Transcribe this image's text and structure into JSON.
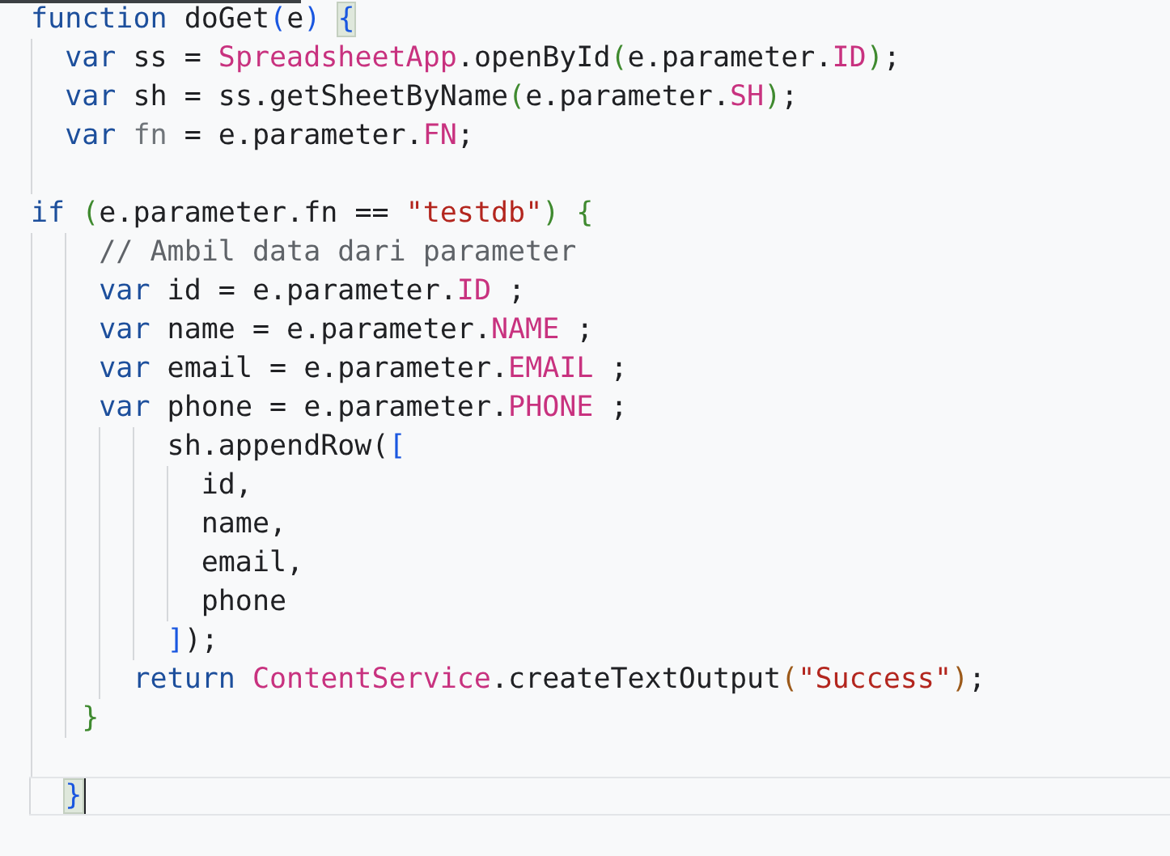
{
  "editor": {
    "lines": [
      {
        "kind": "code",
        "tokens": [
          {
            "kind": "keyword",
            "text": "function"
          },
          {
            "kind": "plain",
            "text": " doGet"
          },
          {
            "kind": "bracket1",
            "text": "("
          },
          {
            "kind": "plain",
            "text": "e"
          },
          {
            "kind": "bracket1",
            "text": ")"
          },
          {
            "kind": "match",
            "text": " {"
          }
        ]
      },
      {
        "kind": "code",
        "tokens": [
          {
            "kind": "keyword",
            "text": "  var"
          },
          {
            "kind": "plain",
            "text": " ss = "
          },
          {
            "kind": "class",
            "text": "SpreadsheetApp"
          },
          {
            "kind": "plain",
            "text": ".openById"
          },
          {
            "kind": "bracket2",
            "text": "("
          },
          {
            "kind": "plain",
            "text": "e.parameter."
          },
          {
            "kind": "class",
            "text": "ID"
          },
          {
            "kind": "bracket2",
            "text": ")"
          },
          {
            "kind": "plain",
            "text": ";"
          }
        ]
      },
      {
        "kind": "code",
        "tokens": [
          {
            "kind": "keyword",
            "text": "  var"
          },
          {
            "kind": "plain",
            "text": " sh = ss.getSheetByName"
          },
          {
            "kind": "bracket2",
            "text": "("
          },
          {
            "kind": "plain",
            "text": "e.parameter."
          },
          {
            "kind": "class",
            "text": "SH"
          },
          {
            "kind": "bracket2",
            "text": ")"
          },
          {
            "kind": "plain",
            "text": ";"
          }
        ]
      },
      {
        "kind": "code",
        "tokens": [
          {
            "kind": "keyword",
            "text": "  var "
          },
          {
            "kind": "unused",
            "text": "fn"
          },
          {
            "kind": "plain",
            "text": " = e.parameter."
          },
          {
            "kind": "class",
            "text": "FN"
          },
          {
            "kind": "plain",
            "text": ";"
          }
        ]
      },
      {
        "kind": "blank"
      },
      {
        "kind": "code",
        "tokens": [
          {
            "kind": "keyword",
            "text": "if "
          },
          {
            "kind": "bracket2",
            "text": "("
          },
          {
            "kind": "plain",
            "text": "e.parameter.fn == "
          },
          {
            "kind": "string",
            "text": "\"testdb\""
          },
          {
            "kind": "bracket2",
            "text": ") {"
          }
        ]
      },
      {
        "kind": "code",
        "tokens": [
          {
            "kind": "comment",
            "text": "    // Ambil data dari parameter"
          }
        ]
      },
      {
        "kind": "code",
        "tokens": [
          {
            "kind": "keyword",
            "text": "    var"
          },
          {
            "kind": "plain",
            "text": " id = e.parameter."
          },
          {
            "kind": "class",
            "text": "ID"
          },
          {
            "kind": "plain",
            "text": " ;"
          }
        ]
      },
      {
        "kind": "code",
        "tokens": [
          {
            "kind": "keyword",
            "text": "    var"
          },
          {
            "kind": "plain",
            "text": " name = e.parameter."
          },
          {
            "kind": "class",
            "text": "NAME"
          },
          {
            "kind": "plain",
            "text": " ;"
          }
        ]
      },
      {
        "kind": "code",
        "tokens": [
          {
            "kind": "keyword",
            "text": "    var"
          },
          {
            "kind": "plain",
            "text": " email = e.parameter."
          },
          {
            "kind": "class",
            "text": "EMAIL"
          },
          {
            "kind": "plain",
            "text": " ;"
          }
        ]
      },
      {
        "kind": "code",
        "tokens": [
          {
            "kind": "keyword",
            "text": "    var"
          },
          {
            "kind": "plain",
            "text": " phone = e.parameter."
          },
          {
            "kind": "class",
            "text": "PHONE"
          },
          {
            "kind": "plain",
            "text": " ;"
          }
        ]
      },
      {
        "kind": "code",
        "tokens": [
          {
            "kind": "plain",
            "text": "        sh.appendRow("
          },
          {
            "kind": "bracket1",
            "text": "["
          }
        ]
      },
      {
        "kind": "code",
        "tokens": [
          {
            "kind": "plain",
            "text": "          id,"
          }
        ]
      },
      {
        "kind": "code",
        "tokens": [
          {
            "kind": "plain",
            "text": "          name,"
          }
        ]
      },
      {
        "kind": "code",
        "tokens": [
          {
            "kind": "plain",
            "text": "          email,"
          }
        ]
      },
      {
        "kind": "code",
        "tokens": [
          {
            "kind": "plain",
            "text": "          phone"
          }
        ]
      },
      {
        "kind": "code",
        "tokens": [
          {
            "kind": "bracket1",
            "text": "        ]"
          },
          {
            "kind": "plain",
            "text": ");"
          }
        ]
      },
      {
        "kind": "code",
        "tokens": [
          {
            "kind": "keyword",
            "text": "      return "
          },
          {
            "kind": "class",
            "text": "ContentService"
          },
          {
            "kind": "plain",
            "text": ".createTextOutput"
          },
          {
            "kind": "bracket3",
            "text": "("
          },
          {
            "kind": "string",
            "text": "\"Success\""
          },
          {
            "kind": "bracket3",
            "text": ")"
          },
          {
            "kind": "plain",
            "text": ";"
          }
        ]
      },
      {
        "kind": "code",
        "tokens": [
          {
            "kind": "bracket2",
            "text": "   }"
          }
        ]
      },
      {
        "kind": "blank"
      },
      {
        "kind": "code",
        "current": true,
        "tokens": [
          {
            "kind": "match",
            "text": "  }"
          }
        ]
      }
    ]
  }
}
